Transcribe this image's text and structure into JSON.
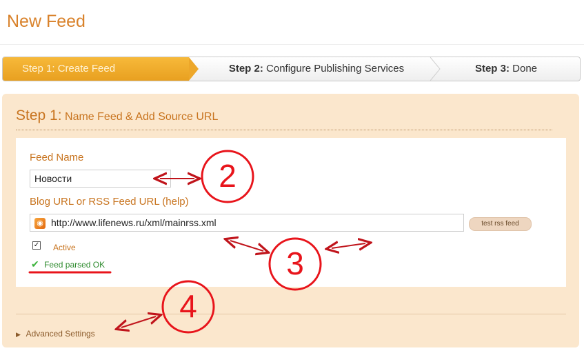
{
  "page": {
    "title": "New Feed"
  },
  "wizard": {
    "step1": {
      "label": "Step 1: Create Feed"
    },
    "step2": {
      "prefix": "Step 2:",
      "label": "Configure Publishing Services"
    },
    "step3": {
      "prefix": "Step 3:",
      "label": "Done"
    }
  },
  "section": {
    "heading_step": "Step 1:",
    "heading_text": "Name Feed & Add Source URL"
  },
  "form": {
    "feed_name_label": "Feed Name",
    "feed_name_value": "Новости",
    "url_label": "Blog URL or RSS Feed URL (help)",
    "url_value": "http://www.lifenews.ru/xml/mainrss.xml",
    "test_button": "test rss feed",
    "active_label": "Active",
    "active_checked": true,
    "parsed_status": "Feed parsed OK"
  },
  "advanced": {
    "label": "Advanced Settings"
  },
  "annotations": {
    "n2": "2",
    "n3": "3",
    "n4": "4"
  },
  "icons": {
    "rss": "rss-icon",
    "check": "check-icon",
    "expand": "triangle-right-icon"
  },
  "colors": {
    "accent": "#e8a020",
    "heading": "#c8741f",
    "panel": "#fbe7cd",
    "marker": "#e8141b",
    "ok": "#2e8b2e"
  }
}
